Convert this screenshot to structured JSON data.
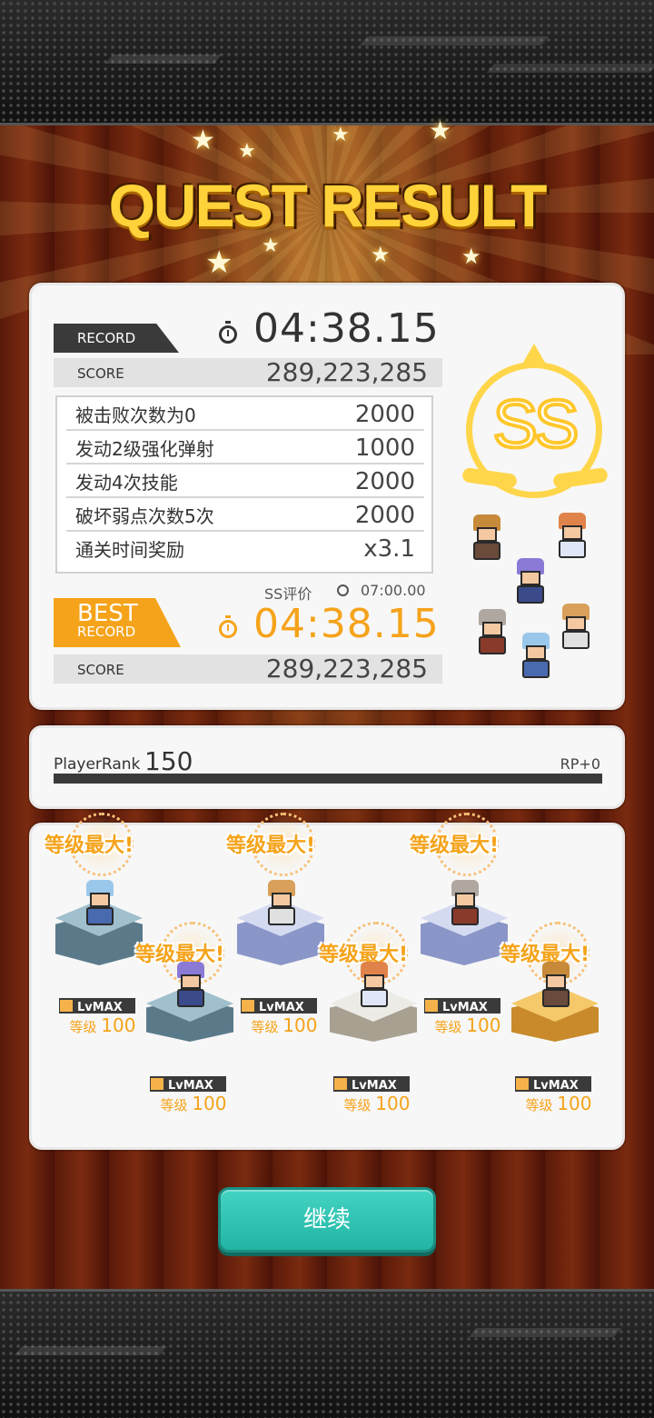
{
  "title": "QUEST RESULT",
  "record": {
    "tag": "RECORD",
    "time": "04:38.15",
    "score_label": "SCORE",
    "score": "289,223,285"
  },
  "bonuses": [
    {
      "name": "被击败次数为0",
      "points": "2000"
    },
    {
      "name": "发动2级强化弹射",
      "points": "1000"
    },
    {
      "name": "发动4次技能",
      "points": "2000"
    },
    {
      "name": "破坏弱点次数5次",
      "points": "2000"
    },
    {
      "name": "通关时间奖励",
      "points": "x3.1"
    }
  ],
  "ss_requirement": {
    "label": "SS评价",
    "time": "07:00.00"
  },
  "best": {
    "tag_line1": "BEST",
    "tag_line2": "RECORD",
    "time": "04:38.15",
    "score_label": "SCORE",
    "score": "289,223,285"
  },
  "grade": "SS",
  "player_rank": {
    "label": "PlayerRank",
    "value": "150",
    "rp": "RP+0",
    "progress": 1.0
  },
  "characters": [
    {
      "lvmax_label": "等级最大!",
      "tag": "LvMAX",
      "level_label": "等级",
      "level": "100",
      "pedestal": "blue"
    },
    {
      "lvmax_label": "等级最大!",
      "tag": "LvMAX",
      "level_label": "等级",
      "level": "100",
      "pedestal": "blue"
    },
    {
      "lvmax_label": "等级最大!",
      "tag": "LvMAX",
      "level_label": "等级",
      "level": "100",
      "pedestal": "lavender"
    },
    {
      "lvmax_label": "等级最大!",
      "tag": "LvMAX",
      "level_label": "等级",
      "level": "100",
      "pedestal": "white"
    },
    {
      "lvmax_label": "等级最大!",
      "tag": "LvMAX",
      "level_label": "等级",
      "level": "100",
      "pedestal": "lavender"
    },
    {
      "lvmax_label": "等级最大!",
      "tag": "LvMAX",
      "level_label": "等级",
      "level": "100",
      "pedestal": "gold"
    }
  ],
  "continue_label": "继续",
  "colors": {
    "accent_orange": "#f5a31a",
    "title_gold": "#ffd23a",
    "button_teal": "#2fc4b2",
    "grade_gold": "#ffd64a"
  }
}
